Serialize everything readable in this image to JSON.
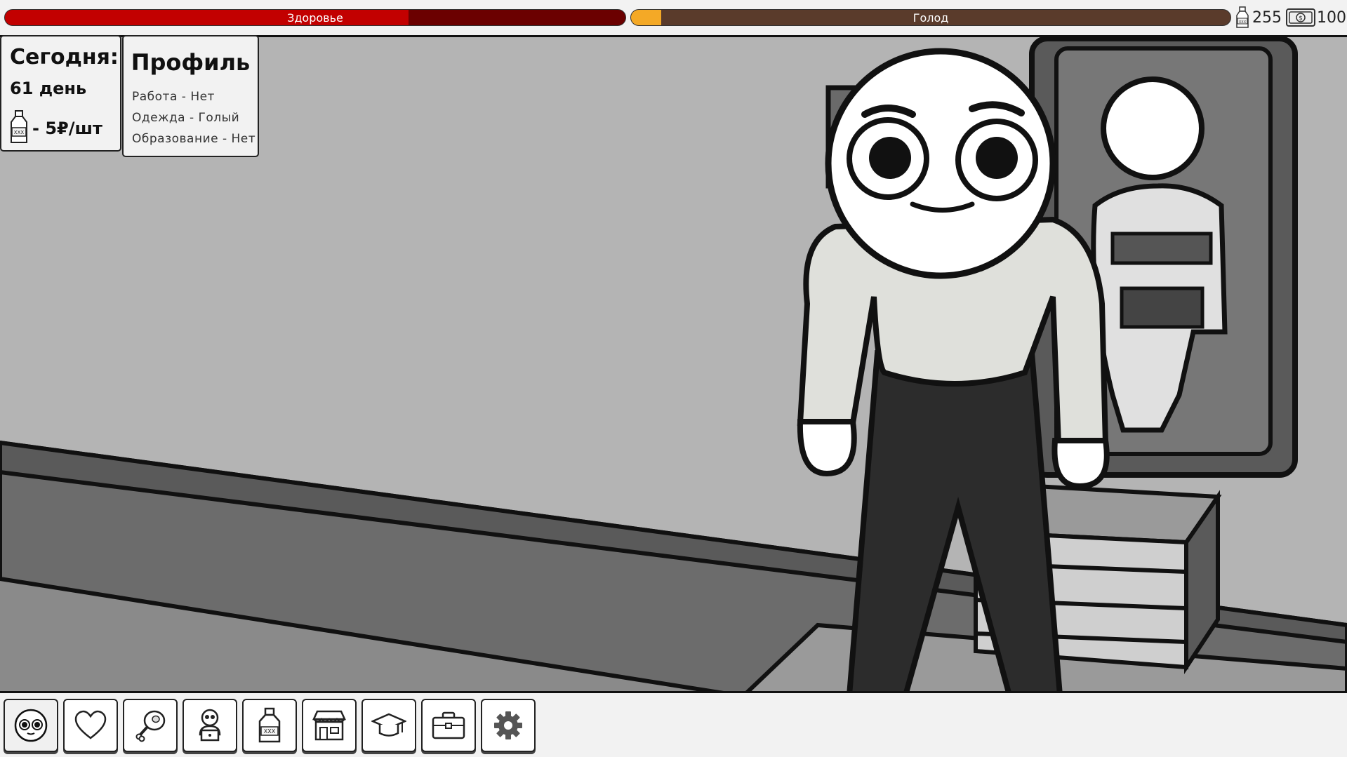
{
  "hud": {
    "health": {
      "label": "Здоровье",
      "level": 0.65
    },
    "hunger": {
      "label": "Голод",
      "level": 0.05
    },
    "bottles": "255",
    "money": "100"
  },
  "today": {
    "title": "Сегодня:",
    "day": "61 день",
    "price": "- 5₽/шт"
  },
  "profile": {
    "title": "Профиль",
    "lines": [
      "Работа - Нет",
      "Одежда - Голый",
      "Образование - Нет"
    ]
  },
  "toolbar": {
    "icons": [
      "face-icon",
      "heart-icon",
      "meat-icon",
      "hacker-icon",
      "bottle-icon",
      "shop-icon",
      "graduation-cap-icon",
      "briefcase-icon",
      "gear-icon"
    ]
  },
  "colors": {
    "health_fill": "#c20000",
    "health_empty": "#6b0000",
    "hunger_fill": "#f4a926",
    "hunger_empty": "#5a3b2b"
  }
}
